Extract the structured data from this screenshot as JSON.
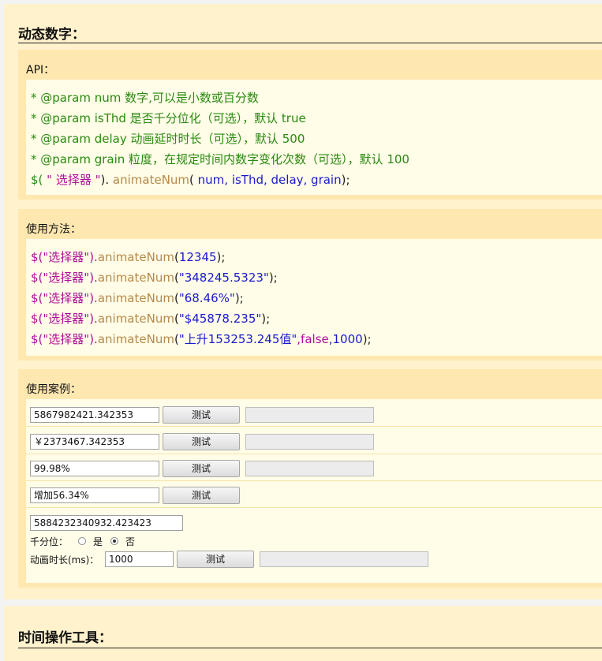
{
  "section1": {
    "title": "动态数字："
  },
  "api": {
    "title": "API：",
    "lines": [
      "* @param num 数字,可以是小数或百分数",
      "* @param isThd 是否千分位化（可选），默认 true",
      "* @param delay 动画延时时长（可选），默认 500",
      "* @param grain 粒度，在规定时间内数字变化次数（可选），默认 100"
    ],
    "sig": {
      "prefix": "$(",
      "selector": " \" 选择器 \"",
      "close": ").",
      "method": " animateNum",
      "open": "( ",
      "args": "num, isThd, delay, grain",
      "end": ");"
    }
  },
  "usage": {
    "title": "使用方法：",
    "lines": [
      {
        "sel": "$(\"选择器\").",
        "method": "animateNum",
        "open": "(",
        "arg": "12345",
        "extra": "",
        "rest": "",
        "end": ");"
      },
      {
        "sel": "$(\"选择器\").",
        "method": "animateNum",
        "open": "(",
        "arg": "\"348245.5323\"",
        "extra": "",
        "rest": "",
        "end": ");"
      },
      {
        "sel": "$(\"选择器\").",
        "method": "animateNum",
        "open": "(",
        "arg": "\"68.46%\"",
        "extra": "",
        "rest": "",
        "end": ");"
      },
      {
        "sel": "$(\"选择器\").",
        "method": "animateNum",
        "open": "(",
        "arg": "\"$45878.235\"",
        "extra": "",
        "rest": "",
        "end": ");"
      },
      {
        "sel": "$(\"选择器\").",
        "method": "animateNum",
        "open": "(",
        "arg": "\"上升153253.245值\"",
        "extra": ",false",
        "rest": ",1000",
        "end": ");"
      }
    ]
  },
  "demo": {
    "title": "使用案例：",
    "test_label": "测试",
    "rows": [
      {
        "value": "5867982421.342353"
      },
      {
        "value": "￥2373467.342353"
      },
      {
        "value": "99.98%"
      },
      {
        "value": "增加56.34%"
      }
    ],
    "custom": {
      "value": "5884232340932.423423",
      "thd_label": "千分位：",
      "yes_label": "是",
      "no_label": "否",
      "delay_label": "动画时长(ms)：",
      "delay_value": "1000"
    }
  },
  "section2": {
    "title": "时间操作工具："
  }
}
